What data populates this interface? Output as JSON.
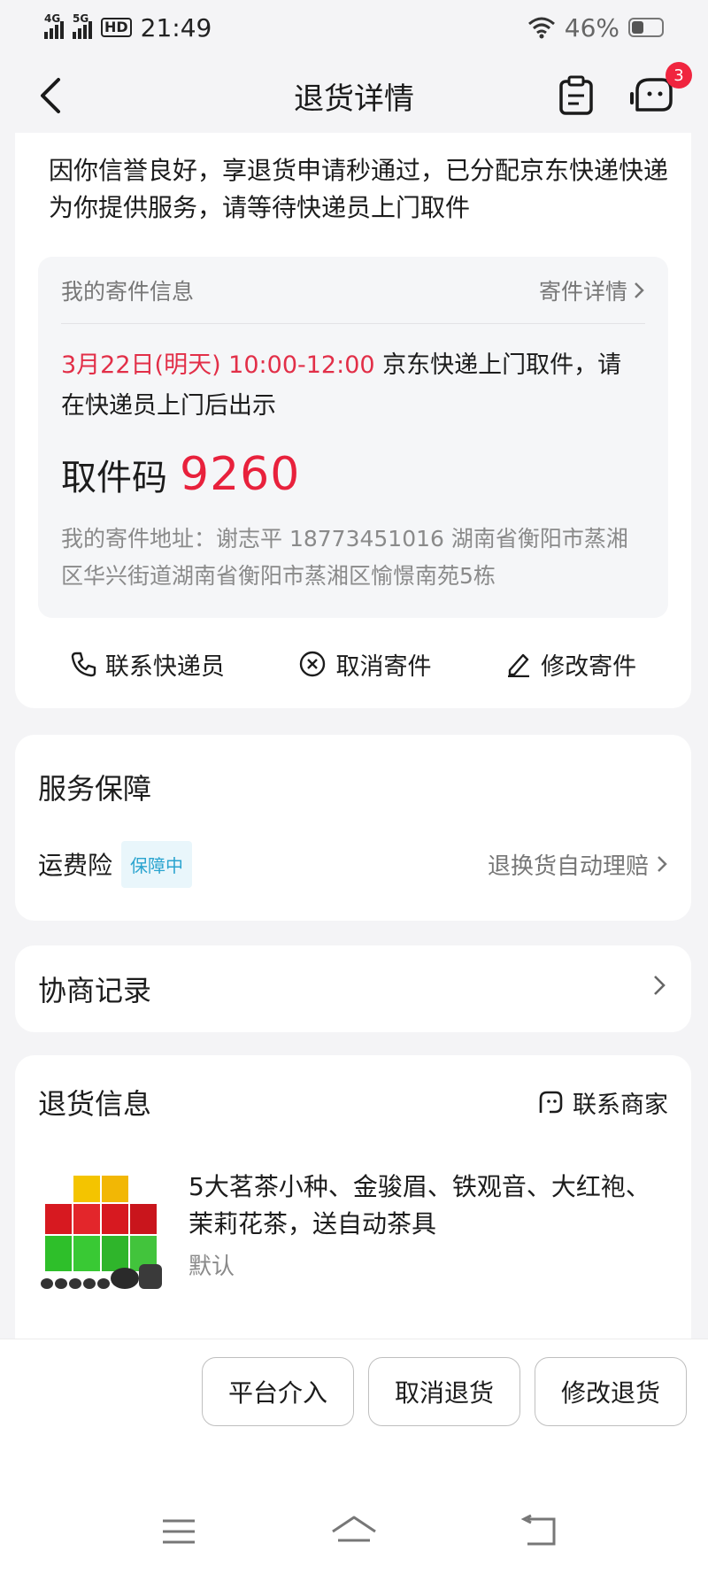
{
  "status_bar": {
    "net1": "4G",
    "net2": "5G",
    "hd": "HD",
    "time": "21:49",
    "battery": "46%"
  },
  "header": {
    "title": "退货详情",
    "badge_count": "3",
    "icons": [
      "back-icon",
      "clipboard-icon",
      "customer-service-icon"
    ]
  },
  "shipping": {
    "notice": "因你信誉良好，享退货申请秒通过，已分配京东快递快递为你提供服务，请等待快递员上门取件",
    "card_title": "我的寄件信息",
    "detail_link": "寄件详情",
    "pickup_time": "3月22日(明天) 10:00-12:00",
    "pickup_text": " 京东快递上门取件，请在快递员上门后出示",
    "code_label": "取件码",
    "code_value": "9260",
    "address": "我的寄件地址：谢志平 18773451016 湖南省衡阳市蒸湘区华兴街道湖南省衡阳市蒸湘区愉憬南苑5栋",
    "actions": {
      "contact": "联系快递员",
      "cancel": "取消寄件",
      "modify": "修改寄件"
    }
  },
  "service": {
    "title": "服务保障",
    "insurance_label": "运费险",
    "insurance_tag": "保障中",
    "insurance_link": "退换货自动理赔"
  },
  "negotiation": {
    "title": "协商记录"
  },
  "return_info": {
    "title": "退货信息",
    "merchant_link": "联系商家",
    "product_title": "5大茗茶小种、金骏眉、铁观音、大红袍、茉莉花茶，送自动茶具",
    "product_spec": "默认"
  },
  "bottom_actions": {
    "platform": "平台介入",
    "cancel_return": "取消退货",
    "modify_return": "修改退货"
  },
  "colors": {
    "accent_red": "#e8213c",
    "tag_blue": "#2aa4cf",
    "tag_bg": "#e9f6fb"
  }
}
